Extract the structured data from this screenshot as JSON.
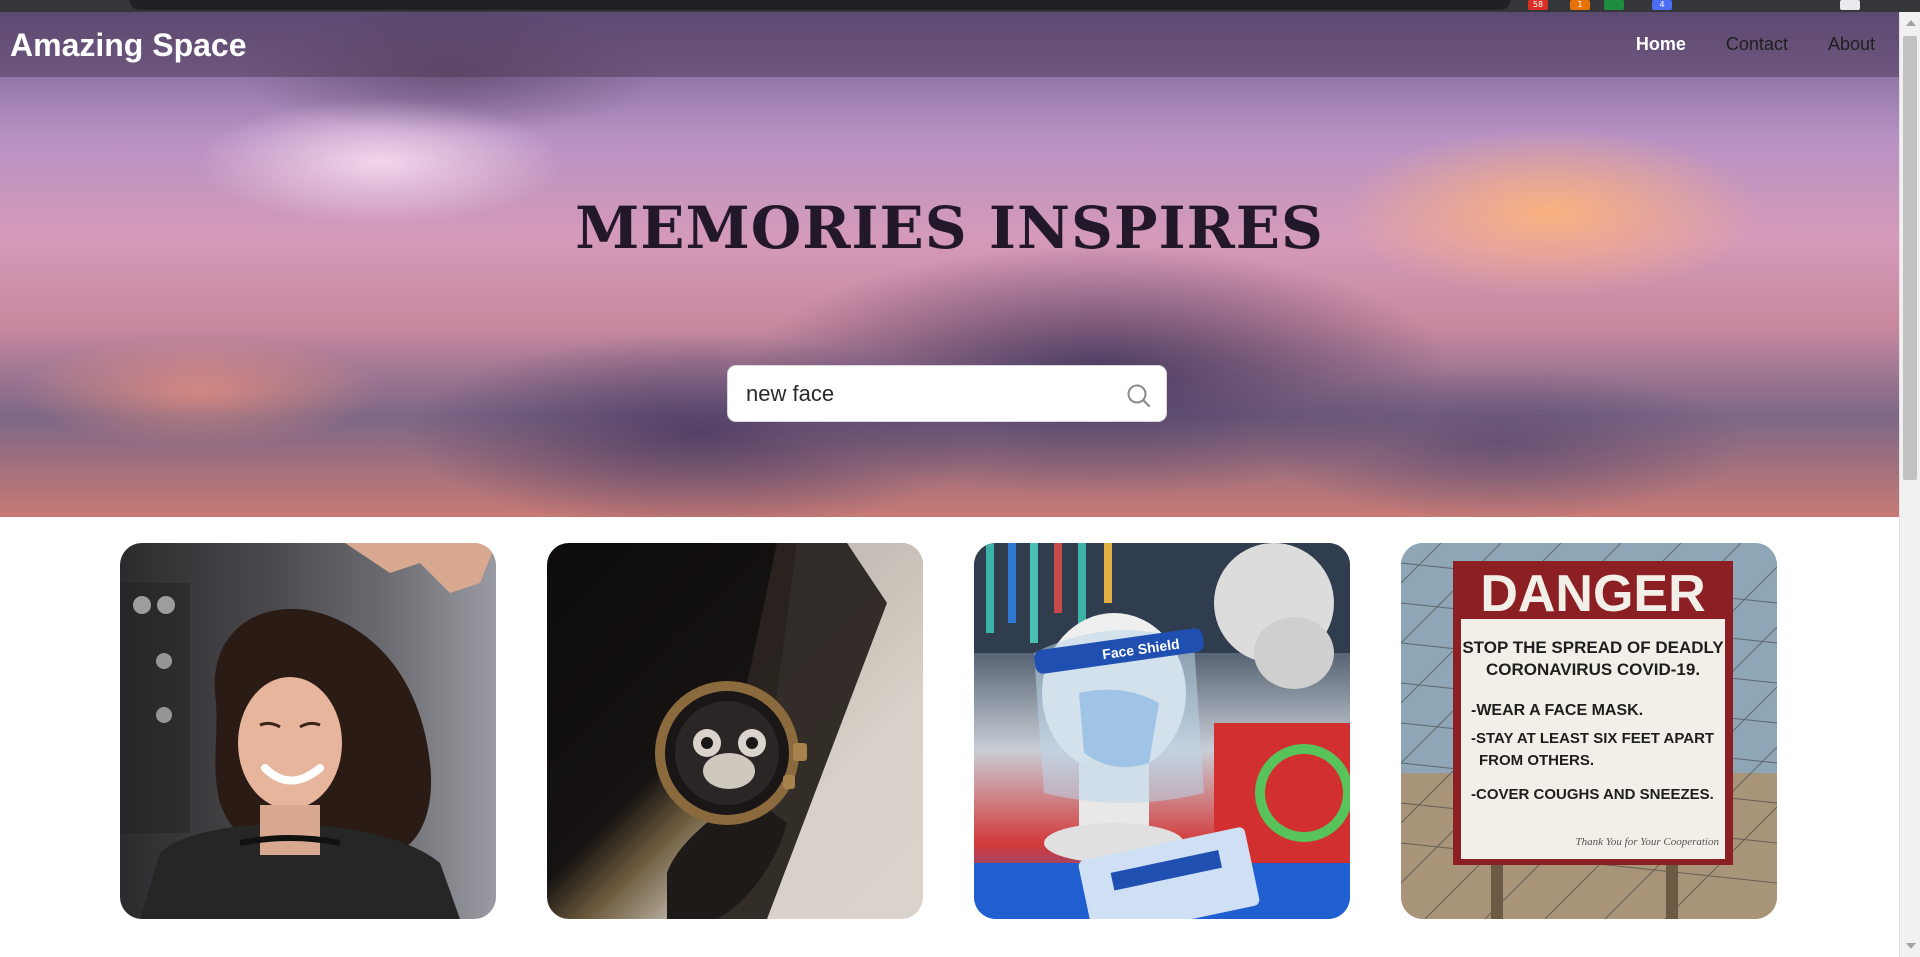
{
  "browser": {
    "extension_badges": [
      "58",
      "1",
      "4"
    ]
  },
  "navbar": {
    "brand": "Amazing Space",
    "links": [
      {
        "label": "Home",
        "active": true
      },
      {
        "label": "Contact",
        "active": false
      },
      {
        "label": "About",
        "active": false
      }
    ]
  },
  "hero": {
    "title": "MEMORIES INSPIRES"
  },
  "search": {
    "value": "new face",
    "icon": "search-icon"
  },
  "gallery": {
    "images": [
      {
        "subject": "smiling woman getting hair styled"
      },
      {
        "subject": "wristwatch with skull dial"
      },
      {
        "subject": "mannequin head with face shield and mask"
      },
      {
        "subject": "danger covid-19 sign",
        "sign_text": {
          "headline": "DANGER",
          "line1": "STOP THE SPREAD OF DEADLY",
          "line2": "CORONAVIRUS COVID-19.",
          "rule1": "-WEAR A FACE MASK.",
          "rule2": "-STAY AT LEAST SIX FEET APART",
          "rule2b": "FROM OTHERS.",
          "rule3": "-COVER COUGHS AND SNEEZES.",
          "footer": "Thank You for Your Cooperation"
        }
      }
    ],
    "shield_label": "Face Shield"
  },
  "colors": {
    "navbar_text": "#ffffff",
    "title_color": "#23182a"
  }
}
